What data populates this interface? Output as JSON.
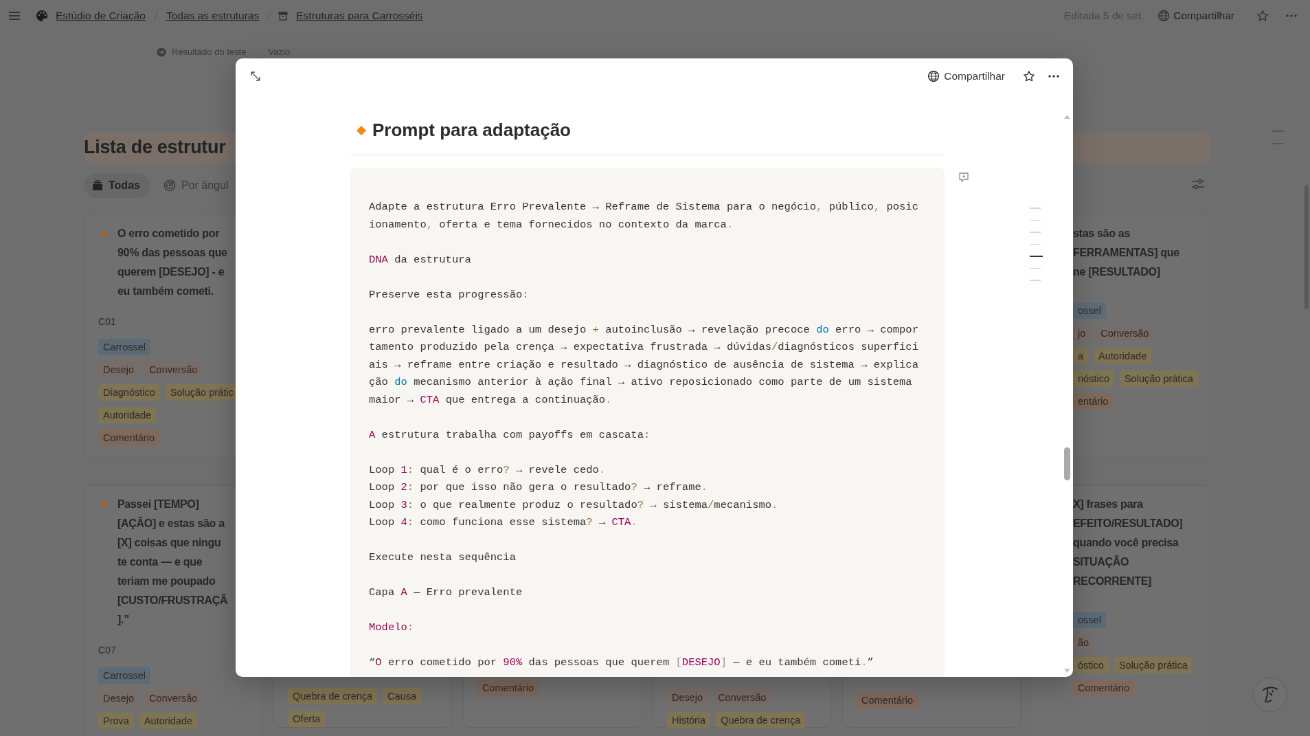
{
  "topbar": {
    "workspace": "Estúdio de Criação",
    "parent": "Todas as estruturas",
    "page": "Estruturas para Carrosséis",
    "edited": "Editada 5 de set.",
    "share": "Compartilhar"
  },
  "property": {
    "label": "Resultado do teste",
    "value": "Vazio"
  },
  "title": "Lista de estrutur",
  "views": [
    {
      "label": "Todas",
      "selected": true
    },
    {
      "label": "Por ângul",
      "selected": false
    }
  ],
  "columns": [
    {
      "kind": "full",
      "cards": [
        {
          "title_lines": [
            "O erro cometido por",
            "90% das pessoas que",
            "querem [DESEJO] - e",
            "eu também cometi."
          ],
          "code": "C01",
          "tag_rows": [
            [
              {
                "text": "Carrossel",
                "color": "#5d6b77"
              }
            ],
            [
              {
                "text": "Desejo",
                "color": "#786c68"
              },
              {
                "text": "Conversão",
                "color": "#786c68"
              }
            ],
            [
              {
                "text": "Diagnóstico",
                "color": "#7f7453"
              },
              {
                "text": "Solução prátic",
                "color": "#7f7453"
              }
            ],
            [
              {
                "text": "Autoridade",
                "color": "#7f7453"
              }
            ],
            [
              {
                "text": "Comentário",
                "color": "#7e695c"
              }
            ]
          ]
        },
        {
          "title_lines": [
            "Passei [TEMPO]",
            "[AÇÃO] e estas são a",
            "[X] coisas que ningu",
            "te conta — e que",
            "teriam me poupado",
            "[CUSTO/FRUSTRAÇÃ",
            "].”"
          ],
          "code": "C07",
          "tag_rows": [
            [
              {
                "text": "Carrossel",
                "color": "#5d6b77"
              }
            ],
            [
              {
                "text": "Desejo",
                "color": "#786c68"
              },
              {
                "text": "Conversão",
                "color": "#786c68"
              }
            ],
            [
              {
                "text": "Prova",
                "color": "#7f7453"
              },
              {
                "text": "Autoridade",
                "color": "#7f7453"
              }
            ]
          ]
        }
      ]
    },
    {
      "kind": "bottom",
      "cards": [
        {
          "tag_rows": [
            [
              {
                "text": "Quebra de crença",
                "color": "#7f7453"
              },
              {
                "text": "Causa",
                "color": "#7f7453"
              }
            ],
            [
              {
                "text": "Oferta",
                "color": "#7f7453"
              }
            ]
          ]
        }
      ]
    },
    {
      "kind": "bottom",
      "cards": [
        {
          "tag_rows": [
            [
              {
                "text": "Comentário",
                "color": "#7e695c"
              }
            ]
          ]
        }
      ]
    },
    {
      "kind": "bottom",
      "cards": [
        {
          "tag_rows": [
            [
              {
                "text": "Desejo",
                "color": "#786c68"
              },
              {
                "text": "Conversão",
                "color": "#786c68"
              }
            ],
            [
              {
                "text": "História",
                "color": "#7f7453"
              },
              {
                "text": "Quebra de crença",
                "color": "#7f7453"
              }
            ]
          ]
        }
      ]
    },
    {
      "kind": "bottom",
      "cards": [
        {
          "tag_rows": [
            [
              {
                "text": "Comentário",
                "color": "#7e695c"
              }
            ]
          ]
        }
      ]
    },
    {
      "kind": "right",
      "cards": [
        {
          "title_lines": [
            "stas são as",
            "FERRAMENTAS] que",
            "ne [RESULTADO]"
          ],
          "tag_rows": [
            [
              {
                "text": "ossel",
                "color": "#5d6b77"
              }
            ],
            [
              {
                "text": "jo",
                "color": "#786c68"
              },
              {
                "text": "Conversão",
                "color": "#786c68"
              }
            ],
            [
              {
                "text": "a",
                "color": "#7f7453"
              },
              {
                "text": "Autoridade",
                "color": "#7f7453"
              }
            ],
            [
              {
                "text": "nóstico",
                "color": "#7f7453"
              },
              {
                "text": "Solução prática",
                "color": "#7f7453"
              }
            ],
            [
              {
                "text": "entário",
                "color": "#7e695c"
              }
            ]
          ]
        },
        {
          "title_lines": [
            "X] frases para",
            "EFEITO/RESULTADO]",
            "quando você precisa",
            "SITUAÇÃO",
            "RECORRENTE]"
          ],
          "tag_rows": [
            [
              {
                "text": "ossel",
                "color": "#5d6b77"
              }
            ],
            [
              {
                "text": "ão",
                "color": "#786c68"
              }
            ],
            [
              {
                "text": "óstico",
                "color": "#7f7453"
              },
              {
                "text": "Solução prática",
                "color": "#7f7453"
              }
            ],
            [
              {
                "text": "Comentário",
                "color": "#7e695c"
              }
            ]
          ]
        }
      ]
    }
  ],
  "modal": {
    "share": "Compartilhar",
    "title": "Prompt para adaptação",
    "code": [
      {
        "lines": [
          [
            {
              "kind": "plain",
              "text": "Adapte a estrutura Erro Prevalente → Reframe de Sistema para o negócio"
            },
            {
              "kind": "punctuation",
              "text": ","
            },
            {
              "kind": "plain",
              "text": " público"
            },
            {
              "kind": "punctuation",
              "text": ","
            },
            {
              "kind": "plain",
              "text": " posicionamento"
            },
            {
              "kind": "punctuation",
              "text": ","
            },
            {
              "kind": "plain",
              "text": " oferta e tema fornecidos no contexto da marca"
            },
            {
              "kind": "punctuation",
              "text": "."
            }
          ]
        ]
      },
      {
        "lines": [
          [
            {
              "kind": "constant",
              "text": "DNA"
            },
            {
              "kind": "plain",
              "text": " da estrutura"
            }
          ]
        ]
      },
      {
        "lines": [
          [
            {
              "kind": "plain",
              "text": "Preserve esta progressão"
            },
            {
              "kind": "operator",
              "text": ":"
            }
          ]
        ]
      },
      {
        "lines": [
          [
            {
              "kind": "plain",
              "text": "erro prevalente ligado a um desejo "
            },
            {
              "kind": "operator",
              "text": "+"
            },
            {
              "kind": "plain",
              "text": " autoinclusão → revelação precoce "
            },
            {
              "kind": "keyword",
              "text": "do"
            },
            {
              "kind": "plain",
              "text": " erro → comportamento produzido pela crença → expectativa frustrada → dúvidas"
            },
            {
              "kind": "operator",
              "text": "/"
            },
            {
              "kind": "plain",
              "text": "diagnósticos superficiais → reframe entre criação e resultado → diagnóstico de ausência de sistema → explicação "
            },
            {
              "kind": "keyword",
              "text": "do"
            },
            {
              "kind": "plain",
              "text": " mecanismo anterior à ação final → ativo reposicionado como parte de um sistema maior → "
            },
            {
              "kind": "constant",
              "text": "CTA"
            },
            {
              "kind": "plain",
              "text": " que entrega a continuação"
            },
            {
              "kind": "punctuation",
              "text": "."
            }
          ]
        ]
      },
      {
        "lines": [
          [
            {
              "kind": "constant",
              "text": "A"
            },
            {
              "kind": "plain",
              "text": " estrutura trabalha com payoffs em cascata"
            },
            {
              "kind": "operator",
              "text": ":"
            }
          ]
        ]
      },
      {
        "lines": [
          [
            {
              "kind": "plain",
              "text": "Loop "
            },
            {
              "kind": "constant",
              "text": "1"
            },
            {
              "kind": "operator",
              "text": ":"
            },
            {
              "kind": "plain",
              "text": " qual é o erro"
            },
            {
              "kind": "operator",
              "text": "?"
            },
            {
              "kind": "plain",
              "text": " → revele cedo"
            },
            {
              "kind": "punctuation",
              "text": "."
            }
          ],
          [
            {
              "kind": "plain",
              "text": "Loop "
            },
            {
              "kind": "constant",
              "text": "2"
            },
            {
              "kind": "operator",
              "text": ":"
            },
            {
              "kind": "plain",
              "text": " por que isso não gera o resultado"
            },
            {
              "kind": "operator",
              "text": "?"
            },
            {
              "kind": "plain",
              "text": " → reframe"
            },
            {
              "kind": "punctuation",
              "text": "."
            }
          ],
          [
            {
              "kind": "plain",
              "text": "Loop "
            },
            {
              "kind": "constant",
              "text": "3"
            },
            {
              "kind": "operator",
              "text": ":"
            },
            {
              "kind": "plain",
              "text": " o que realmente produz o resultado"
            },
            {
              "kind": "operator",
              "text": "?"
            },
            {
              "kind": "plain",
              "text": " → sistema"
            },
            {
              "kind": "operator",
              "text": "/"
            },
            {
              "kind": "plain",
              "text": "mecanismo"
            },
            {
              "kind": "punctuation",
              "text": "."
            }
          ],
          [
            {
              "kind": "plain",
              "text": "Loop "
            },
            {
              "kind": "constant",
              "text": "4"
            },
            {
              "kind": "operator",
              "text": ":"
            },
            {
              "kind": "plain",
              "text": " como funciona esse sistema"
            },
            {
              "kind": "operator",
              "text": "?"
            },
            {
              "kind": "plain",
              "text": " → "
            },
            {
              "kind": "constant",
              "text": "CTA"
            },
            {
              "kind": "punctuation",
              "text": "."
            }
          ]
        ]
      },
      {
        "lines": [
          [
            {
              "kind": "plain",
              "text": "Execute nesta sequência"
            }
          ]
        ]
      },
      {
        "lines": [
          [
            {
              "kind": "plain",
              "text": "Capa "
            },
            {
              "kind": "constant",
              "text": "A"
            },
            {
              "kind": "plain",
              "text": " — Erro prevalente"
            }
          ]
        ]
      },
      {
        "lines": [
          [
            {
              "kind": "constant",
              "text": "Modelo"
            },
            {
              "kind": "operator",
              "text": ":"
            }
          ]
        ]
      },
      {
        "lines": [
          [
            {
              "kind": "plain",
              "text": "“"
            },
            {
              "kind": "constant",
              "text": "O"
            },
            {
              "kind": "plain",
              "text": " erro cometido por "
            },
            {
              "kind": "constant",
              "text": "90%"
            },
            {
              "kind": "plain",
              "text": " das pessoas que querem "
            },
            {
              "kind": "punctuation",
              "text": "["
            },
            {
              "kind": "constant",
              "text": "DESEJO"
            },
            {
              "kind": "punctuation",
              "text": "]"
            },
            {
              "kind": "plain",
              "text": " — e eu também cometi"
            },
            {
              "kind": "punctuation",
              "text": "."
            },
            {
              "kind": "plain",
              "text": "”"
            }
          ]
        ]
      }
    ]
  }
}
